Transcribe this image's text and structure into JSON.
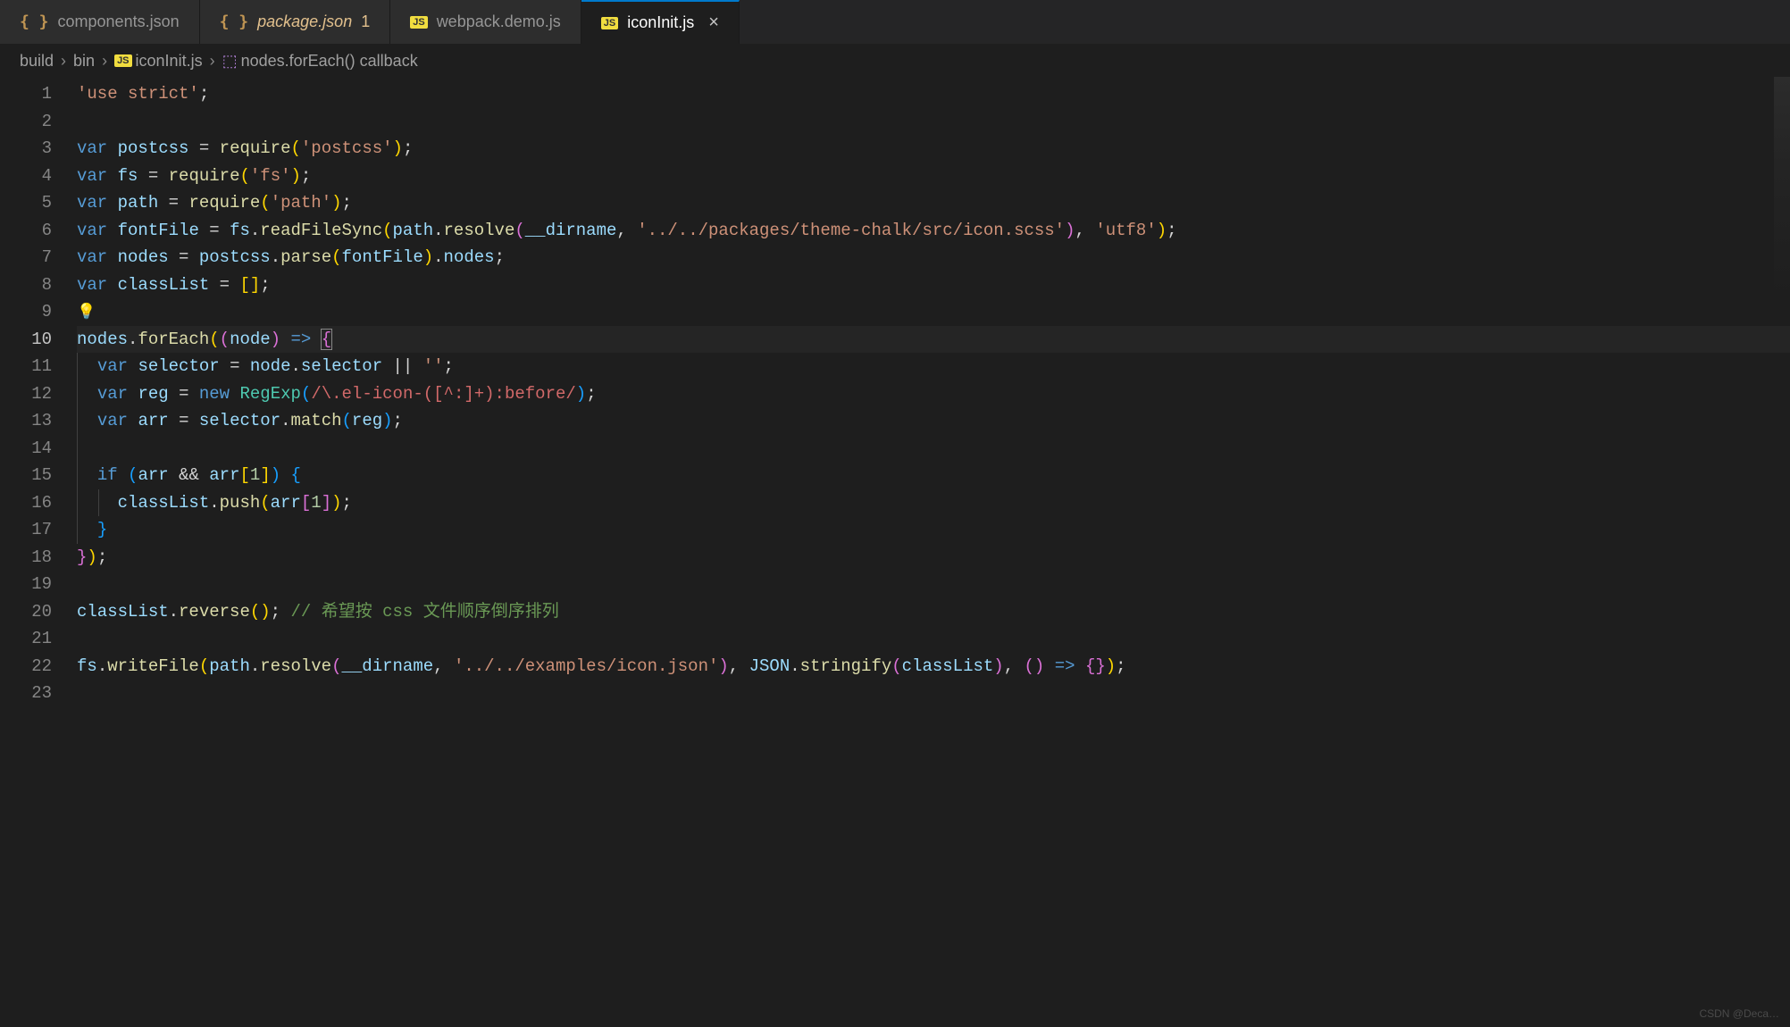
{
  "tabs": [
    {
      "icon": "braces",
      "label": "components.json",
      "modified": "",
      "active": false,
      "italic": false
    },
    {
      "icon": "braces",
      "label": "package.json",
      "modified": "1",
      "active": false,
      "italic": true
    },
    {
      "icon": "js",
      "label": "webpack.demo.js",
      "modified": "",
      "active": false,
      "italic": false
    },
    {
      "icon": "js",
      "label": "iconInit.js",
      "modified": "",
      "active": true,
      "italic": false
    }
  ],
  "breadcrumbs": {
    "parts": [
      "build",
      "bin",
      "iconInit.js",
      "nodes.forEach() callback"
    ],
    "file_icon": "js",
    "symbol_icon": "cube"
  },
  "line_numbers": [
    "1",
    "2",
    "3",
    "4",
    "5",
    "6",
    "7",
    "8",
    "9",
    "10",
    "11",
    "12",
    "13",
    "14",
    "15",
    "16",
    "17",
    "18",
    "19",
    "20",
    "21",
    "22",
    "23"
  ],
  "current_line": 10,
  "code": {
    "l1": [
      [
        "str",
        "'use strict'"
      ],
      [
        "pun",
        ";"
      ]
    ],
    "l2": [],
    "l3": [
      [
        "kw",
        "var"
      ],
      [
        "op",
        " "
      ],
      [
        "var",
        "postcss"
      ],
      [
        "op",
        " "
      ],
      [
        "op",
        "="
      ],
      [
        "op",
        " "
      ],
      [
        "fn",
        "require"
      ],
      [
        "br0",
        "("
      ],
      [
        "str",
        "'postcss'"
      ],
      [
        "br0",
        ")"
      ],
      [
        "pun",
        ";"
      ]
    ],
    "l4": [
      [
        "kw",
        "var"
      ],
      [
        "op",
        " "
      ],
      [
        "var",
        "fs"
      ],
      [
        "op",
        " "
      ],
      [
        "op",
        "="
      ],
      [
        "op",
        " "
      ],
      [
        "fn",
        "require"
      ],
      [
        "br0",
        "("
      ],
      [
        "str",
        "'fs'"
      ],
      [
        "br0",
        ")"
      ],
      [
        "pun",
        ";"
      ]
    ],
    "l5": [
      [
        "kw",
        "var"
      ],
      [
        "op",
        " "
      ],
      [
        "var",
        "path"
      ],
      [
        "op",
        " "
      ],
      [
        "op",
        "="
      ],
      [
        "op",
        " "
      ],
      [
        "fn",
        "require"
      ],
      [
        "br0",
        "("
      ],
      [
        "str",
        "'path'"
      ],
      [
        "br0",
        ")"
      ],
      [
        "pun",
        ";"
      ]
    ],
    "l6": [
      [
        "kw",
        "var"
      ],
      [
        "op",
        " "
      ],
      [
        "var",
        "fontFile"
      ],
      [
        "op",
        " "
      ],
      [
        "op",
        "="
      ],
      [
        "op",
        " "
      ],
      [
        "var",
        "fs"
      ],
      [
        "pun",
        "."
      ],
      [
        "fn",
        "readFileSync"
      ],
      [
        "br0",
        "("
      ],
      [
        "var",
        "path"
      ],
      [
        "pun",
        "."
      ],
      [
        "fn",
        "resolve"
      ],
      [
        "br1",
        "("
      ],
      [
        "var",
        "__dirname"
      ],
      [
        "pun",
        ","
      ],
      [
        "op",
        " "
      ],
      [
        "str",
        "'../../packages/theme-chalk/src/icon.scss'"
      ],
      [
        "br1",
        ")"
      ],
      [
        "pun",
        ","
      ],
      [
        "op",
        " "
      ],
      [
        "str",
        "'utf8'"
      ],
      [
        "br0",
        ")"
      ],
      [
        "pun",
        ";"
      ]
    ],
    "l7": [
      [
        "kw",
        "var"
      ],
      [
        "op",
        " "
      ],
      [
        "var",
        "nodes"
      ],
      [
        "op",
        " "
      ],
      [
        "op",
        "="
      ],
      [
        "op",
        " "
      ],
      [
        "var",
        "postcss"
      ],
      [
        "pun",
        "."
      ],
      [
        "fn",
        "parse"
      ],
      [
        "br0",
        "("
      ],
      [
        "var",
        "fontFile"
      ],
      [
        "br0",
        ")"
      ],
      [
        "pun",
        "."
      ],
      [
        "prop",
        "nodes"
      ],
      [
        "pun",
        ";"
      ]
    ],
    "l8": [
      [
        "kw",
        "var"
      ],
      [
        "op",
        " "
      ],
      [
        "var",
        "classList"
      ],
      [
        "op",
        " "
      ],
      [
        "op",
        "="
      ],
      [
        "op",
        " "
      ],
      [
        "br0",
        "["
      ],
      [
        "br0",
        "]"
      ],
      [
        "pun",
        ";"
      ]
    ],
    "l9": [
      [
        "bulb",
        "💡"
      ]
    ],
    "l10": [
      [
        "var",
        "nodes"
      ],
      [
        "pun",
        "."
      ],
      [
        "fn",
        "forEach"
      ],
      [
        "br0",
        "("
      ],
      [
        "br1",
        "("
      ],
      [
        "var",
        "node"
      ],
      [
        "br1",
        ")"
      ],
      [
        "op",
        " "
      ],
      [
        "kw",
        "=>"
      ],
      [
        "op",
        " "
      ],
      [
        "br1-box",
        "{"
      ]
    ],
    "l11": [
      [
        "op",
        "  "
      ],
      [
        "kw",
        "var"
      ],
      [
        "op",
        " "
      ],
      [
        "var",
        "selector"
      ],
      [
        "op",
        " "
      ],
      [
        "op",
        "="
      ],
      [
        "op",
        " "
      ],
      [
        "var",
        "node"
      ],
      [
        "pun",
        "."
      ],
      [
        "prop",
        "selector"
      ],
      [
        "op",
        " "
      ],
      [
        "op",
        "||"
      ],
      [
        "op",
        " "
      ],
      [
        "str",
        "''"
      ],
      [
        "pun",
        ";"
      ]
    ],
    "l12": [
      [
        "op",
        "  "
      ],
      [
        "kw",
        "var"
      ],
      [
        "op",
        " "
      ],
      [
        "var",
        "reg"
      ],
      [
        "op",
        " "
      ],
      [
        "op",
        "="
      ],
      [
        "op",
        " "
      ],
      [
        "kw",
        "new"
      ],
      [
        "op",
        " "
      ],
      [
        "cls",
        "RegExp"
      ],
      [
        "br2",
        "("
      ],
      [
        "reg",
        "/\\.el-icon-([^:]+):before/"
      ],
      [
        "br2",
        ")"
      ],
      [
        "pun",
        ";"
      ]
    ],
    "l13": [
      [
        "op",
        "  "
      ],
      [
        "kw",
        "var"
      ],
      [
        "op",
        " "
      ],
      [
        "var",
        "arr"
      ],
      [
        "op",
        " "
      ],
      [
        "op",
        "="
      ],
      [
        "op",
        " "
      ],
      [
        "var",
        "selector"
      ],
      [
        "pun",
        "."
      ],
      [
        "fn",
        "match"
      ],
      [
        "br2",
        "("
      ],
      [
        "var",
        "reg"
      ],
      [
        "br2",
        ")"
      ],
      [
        "pun",
        ";"
      ]
    ],
    "l14": [],
    "l15": [
      [
        "op",
        "  "
      ],
      [
        "kw",
        "if"
      ],
      [
        "op",
        " "
      ],
      [
        "br2",
        "("
      ],
      [
        "var",
        "arr"
      ],
      [
        "op",
        " "
      ],
      [
        "op",
        "&&"
      ],
      [
        "op",
        " "
      ],
      [
        "var",
        "arr"
      ],
      [
        "br0",
        "["
      ],
      [
        "num",
        "1"
      ],
      [
        "br0",
        "]"
      ],
      [
        "br2",
        ")"
      ],
      [
        "op",
        " "
      ],
      [
        "br2",
        "{"
      ]
    ],
    "l16": [
      [
        "op",
        "    "
      ],
      [
        "var",
        "classList"
      ],
      [
        "pun",
        "."
      ],
      [
        "fn",
        "push"
      ],
      [
        "br0",
        "("
      ],
      [
        "var",
        "arr"
      ],
      [
        "br1",
        "["
      ],
      [
        "num",
        "1"
      ],
      [
        "br1",
        "]"
      ],
      [
        "br0",
        ")"
      ],
      [
        "pun",
        ";"
      ]
    ],
    "l17": [
      [
        "op",
        "  "
      ],
      [
        "br2",
        "}"
      ]
    ],
    "l18": [
      [
        "br1",
        "}"
      ],
      [
        "br0",
        ")"
      ],
      [
        "pun",
        ";"
      ]
    ],
    "l19": [],
    "l20": [
      [
        "var",
        "classList"
      ],
      [
        "pun",
        "."
      ],
      [
        "fn",
        "reverse"
      ],
      [
        "br0",
        "("
      ],
      [
        "br0",
        ")"
      ],
      [
        "pun",
        ";"
      ],
      [
        "op",
        " "
      ],
      [
        "cmt",
        "// 希望按 css 文件顺序倒序排列"
      ]
    ],
    "l21": [],
    "l22": [
      [
        "var",
        "fs"
      ],
      [
        "pun",
        "."
      ],
      [
        "fn",
        "writeFile"
      ],
      [
        "br0",
        "("
      ],
      [
        "var",
        "path"
      ],
      [
        "pun",
        "."
      ],
      [
        "fn",
        "resolve"
      ],
      [
        "br1",
        "("
      ],
      [
        "var",
        "__dirname"
      ],
      [
        "pun",
        ","
      ],
      [
        "op",
        " "
      ],
      [
        "str",
        "'../../examples/icon.json'"
      ],
      [
        "br1",
        ")"
      ],
      [
        "pun",
        ","
      ],
      [
        "op",
        " "
      ],
      [
        "var",
        "JSON"
      ],
      [
        "pun",
        "."
      ],
      [
        "fn",
        "stringify"
      ],
      [
        "br1",
        "("
      ],
      [
        "var",
        "classList"
      ],
      [
        "br1",
        ")"
      ],
      [
        "pun",
        ","
      ],
      [
        "op",
        " "
      ],
      [
        "br1",
        "("
      ],
      [
        "br1",
        ")"
      ],
      [
        "op",
        " "
      ],
      [
        "kw",
        "=>"
      ],
      [
        "op",
        " "
      ],
      [
        "br1",
        "{"
      ],
      [
        "br1",
        "}"
      ],
      [
        "br0",
        ")"
      ],
      [
        "pun",
        ";"
      ]
    ],
    "l23": []
  },
  "watermark": "CSDN @Deca…"
}
